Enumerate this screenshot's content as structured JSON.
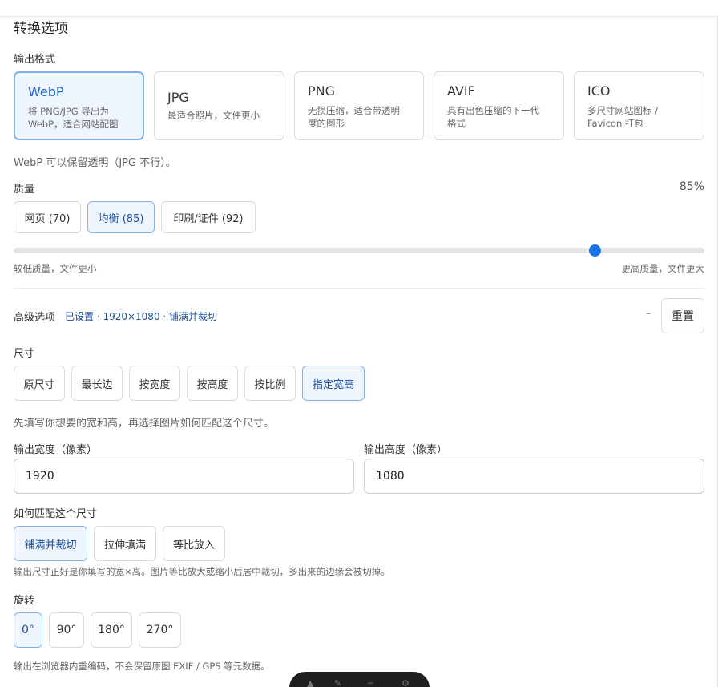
{
  "title": "转换选项",
  "output_format": {
    "label": "输出格式",
    "cards": [
      {
        "name": "WebP",
        "desc_line1": "将 PNG/JPG 导出为",
        "desc_line2": "WebP，适合网站配图",
        "active": true
      },
      {
        "name": "JPG",
        "desc_line1": "最适合照片，文件更小",
        "desc_line2": ""
      },
      {
        "name": "PNG",
        "desc_line1": "无损压缩，适合带透明",
        "desc_line2": "度的图形"
      },
      {
        "name": "AVIF",
        "desc_line1": "具有出色压缩的下一代",
        "desc_line2": "格式"
      },
      {
        "name": "ICO",
        "desc_line1": "多尺寸网站图标 /",
        "desc_line2": "Favicon 打包"
      }
    ],
    "note": "WebP 可以保留透明（JPG 不行）。"
  },
  "quality": {
    "label": "质量",
    "value_text": "85%",
    "value": 85,
    "presets": [
      "网页 (70)",
      "均衡 (85)",
      "印刷/证件 (92)"
    ],
    "active_preset": 1,
    "min_label": "较低质量，文件更小",
    "max_label": "更高质量，文件更大"
  },
  "advanced": {
    "label": "高级选项",
    "summary": "已设置 · 1920×1080 · 铺满并裁切",
    "collapse": "–",
    "reset": "重置"
  },
  "size": {
    "label": "尺寸",
    "modes": [
      "原尺寸",
      "最长边",
      "按宽度",
      "按高度",
      "按比例",
      "指定宽高"
    ],
    "active_mode": 5,
    "hint": "先填写你想要的宽和高，再选择图片如何匹配这个尺寸。",
    "width_label": "输出宽度（像素）",
    "width_value": "1920",
    "height_label": "输出高度（像素）",
    "height_value": "1080"
  },
  "fit": {
    "label": "如何匹配这个尺寸",
    "modes": [
      "铺满并裁切",
      "拉伸填满",
      "等比放入"
    ],
    "active_mode": 0,
    "hint": "输出尺寸正好是你填写的宽×高。图片等比放大或缩小后居中裁切，多出来的边缘会被切掉。"
  },
  "rotate": {
    "label": "旋转",
    "options": [
      "0°",
      "90°",
      "180°",
      "270°"
    ],
    "active": 0
  },
  "footer_note": "输出在浏览器内重编码，不会保留原图 EXIF / GPS 等元数据。",
  "colors": {
    "accent": "#1a73e8",
    "active_bg": "#eef5ff",
    "active_border": "#7fb0ec"
  }
}
